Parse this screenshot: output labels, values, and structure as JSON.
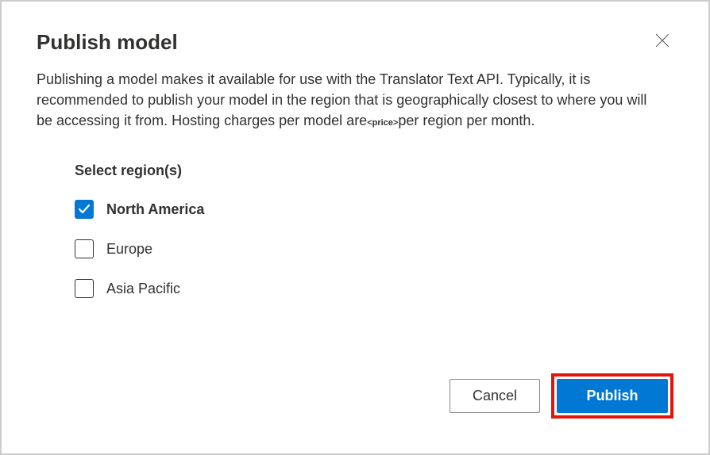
{
  "dialog": {
    "title": "Publish model",
    "description_pre": "Publishing a model makes it available for use with the Translator Text API. Typically, it is recommended to publish your model in the region that is geographically closest to where you will be accessing it from. Hosting charges per model are",
    "price_token": "<price>",
    "description_post": "per region per month."
  },
  "regions": {
    "label": "Select region(s)",
    "items": [
      {
        "name": "North America",
        "checked": true
      },
      {
        "name": "Europe",
        "checked": false
      },
      {
        "name": "Asia Pacific",
        "checked": false
      }
    ]
  },
  "buttons": {
    "cancel": "Cancel",
    "publish": "Publish"
  }
}
